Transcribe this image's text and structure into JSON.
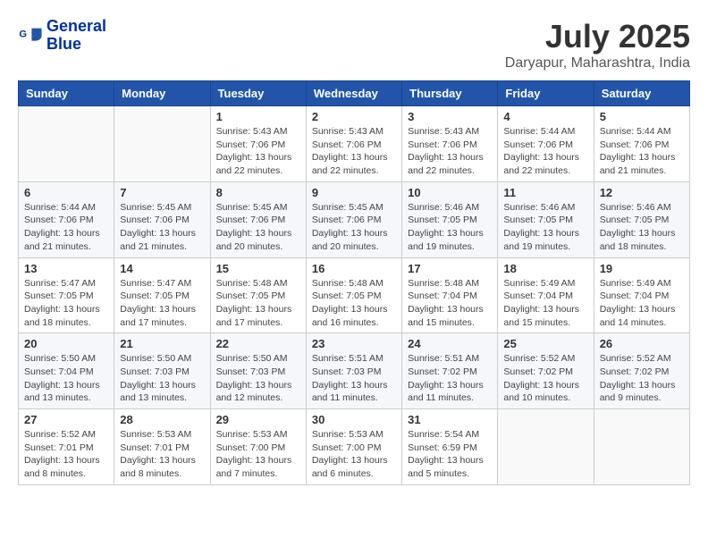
{
  "logo": {
    "line1": "General",
    "line2": "Blue"
  },
  "title": "July 2025",
  "location": "Daryapur, Maharashtra, India",
  "weekdays": [
    "Sunday",
    "Monday",
    "Tuesday",
    "Wednesday",
    "Thursday",
    "Friday",
    "Saturday"
  ],
  "weeks": [
    [
      {
        "day": "",
        "info": ""
      },
      {
        "day": "",
        "info": ""
      },
      {
        "day": "1",
        "info": "Sunrise: 5:43 AM\nSunset: 7:06 PM\nDaylight: 13 hours and 22 minutes."
      },
      {
        "day": "2",
        "info": "Sunrise: 5:43 AM\nSunset: 7:06 PM\nDaylight: 13 hours and 22 minutes."
      },
      {
        "day": "3",
        "info": "Sunrise: 5:43 AM\nSunset: 7:06 PM\nDaylight: 13 hours and 22 minutes."
      },
      {
        "day": "4",
        "info": "Sunrise: 5:44 AM\nSunset: 7:06 PM\nDaylight: 13 hours and 22 minutes."
      },
      {
        "day": "5",
        "info": "Sunrise: 5:44 AM\nSunset: 7:06 PM\nDaylight: 13 hours and 21 minutes."
      }
    ],
    [
      {
        "day": "6",
        "info": "Sunrise: 5:44 AM\nSunset: 7:06 PM\nDaylight: 13 hours and 21 minutes."
      },
      {
        "day": "7",
        "info": "Sunrise: 5:45 AM\nSunset: 7:06 PM\nDaylight: 13 hours and 21 minutes."
      },
      {
        "day": "8",
        "info": "Sunrise: 5:45 AM\nSunset: 7:06 PM\nDaylight: 13 hours and 20 minutes."
      },
      {
        "day": "9",
        "info": "Sunrise: 5:45 AM\nSunset: 7:06 PM\nDaylight: 13 hours and 20 minutes."
      },
      {
        "day": "10",
        "info": "Sunrise: 5:46 AM\nSunset: 7:05 PM\nDaylight: 13 hours and 19 minutes."
      },
      {
        "day": "11",
        "info": "Sunrise: 5:46 AM\nSunset: 7:05 PM\nDaylight: 13 hours and 19 minutes."
      },
      {
        "day": "12",
        "info": "Sunrise: 5:46 AM\nSunset: 7:05 PM\nDaylight: 13 hours and 18 minutes."
      }
    ],
    [
      {
        "day": "13",
        "info": "Sunrise: 5:47 AM\nSunset: 7:05 PM\nDaylight: 13 hours and 18 minutes."
      },
      {
        "day": "14",
        "info": "Sunrise: 5:47 AM\nSunset: 7:05 PM\nDaylight: 13 hours and 17 minutes."
      },
      {
        "day": "15",
        "info": "Sunrise: 5:48 AM\nSunset: 7:05 PM\nDaylight: 13 hours and 17 minutes."
      },
      {
        "day": "16",
        "info": "Sunrise: 5:48 AM\nSunset: 7:05 PM\nDaylight: 13 hours and 16 minutes."
      },
      {
        "day": "17",
        "info": "Sunrise: 5:48 AM\nSunset: 7:04 PM\nDaylight: 13 hours and 15 minutes."
      },
      {
        "day": "18",
        "info": "Sunrise: 5:49 AM\nSunset: 7:04 PM\nDaylight: 13 hours and 15 minutes."
      },
      {
        "day": "19",
        "info": "Sunrise: 5:49 AM\nSunset: 7:04 PM\nDaylight: 13 hours and 14 minutes."
      }
    ],
    [
      {
        "day": "20",
        "info": "Sunrise: 5:50 AM\nSunset: 7:04 PM\nDaylight: 13 hours and 13 minutes."
      },
      {
        "day": "21",
        "info": "Sunrise: 5:50 AM\nSunset: 7:03 PM\nDaylight: 13 hours and 13 minutes."
      },
      {
        "day": "22",
        "info": "Sunrise: 5:50 AM\nSunset: 7:03 PM\nDaylight: 13 hours and 12 minutes."
      },
      {
        "day": "23",
        "info": "Sunrise: 5:51 AM\nSunset: 7:03 PM\nDaylight: 13 hours and 11 minutes."
      },
      {
        "day": "24",
        "info": "Sunrise: 5:51 AM\nSunset: 7:02 PM\nDaylight: 13 hours and 11 minutes."
      },
      {
        "day": "25",
        "info": "Sunrise: 5:52 AM\nSunset: 7:02 PM\nDaylight: 13 hours and 10 minutes."
      },
      {
        "day": "26",
        "info": "Sunrise: 5:52 AM\nSunset: 7:02 PM\nDaylight: 13 hours and 9 minutes."
      }
    ],
    [
      {
        "day": "27",
        "info": "Sunrise: 5:52 AM\nSunset: 7:01 PM\nDaylight: 13 hours and 8 minutes."
      },
      {
        "day": "28",
        "info": "Sunrise: 5:53 AM\nSunset: 7:01 PM\nDaylight: 13 hours and 8 minutes."
      },
      {
        "day": "29",
        "info": "Sunrise: 5:53 AM\nSunset: 7:00 PM\nDaylight: 13 hours and 7 minutes."
      },
      {
        "day": "30",
        "info": "Sunrise: 5:53 AM\nSunset: 7:00 PM\nDaylight: 13 hours and 6 minutes."
      },
      {
        "day": "31",
        "info": "Sunrise: 5:54 AM\nSunset: 6:59 PM\nDaylight: 13 hours and 5 minutes."
      },
      {
        "day": "",
        "info": ""
      },
      {
        "day": "",
        "info": ""
      }
    ]
  ]
}
